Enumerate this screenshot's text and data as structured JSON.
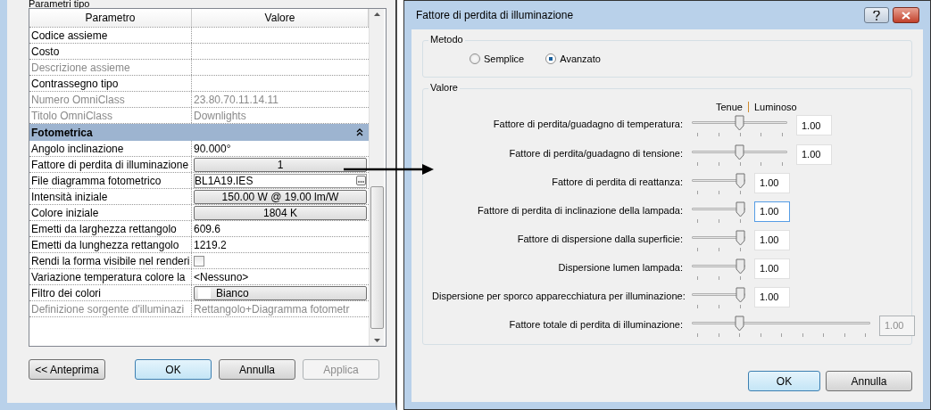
{
  "type_dialog": {
    "group_label": "Parametri tipo",
    "table": {
      "columns": [
        "Parametro",
        "Valore"
      ],
      "rows": [
        {
          "kind": "text",
          "name": "Codice assieme",
          "disabled": false
        },
        {
          "kind": "text",
          "name": "Costo",
          "disabled": false
        },
        {
          "kind": "text",
          "name": "Descrizione assieme",
          "disabled": true
        },
        {
          "kind": "text",
          "name": "Contrassegno tipo",
          "disabled": false
        },
        {
          "kind": "text",
          "name": "Numero OmniClass",
          "value": "23.80.70.11.14.11",
          "disabled": true
        },
        {
          "kind": "text",
          "name": "Titolo OmniClass",
          "value": "Downlights",
          "disabled": true
        },
        {
          "kind": "group",
          "label": "Fotometrica",
          "expanded": true
        },
        {
          "kind": "text",
          "name": "Angolo inclinazione",
          "value": "90.000°",
          "disabled": false
        },
        {
          "kind": "button",
          "name": "Fattore di perdita di illuminazione",
          "value": "1",
          "disabled": false
        },
        {
          "kind": "file",
          "name": "File diagramma fotometrico",
          "value": "BL1A19.IES",
          "disabled": false
        },
        {
          "kind": "button",
          "name": "Intensità iniziale",
          "value": "150.00 W @ 19.00 lm/W",
          "disabled": false
        },
        {
          "kind": "button",
          "name": "Colore iniziale",
          "value": "1804 K",
          "disabled": false
        },
        {
          "kind": "text",
          "name": "Emetti da larghezza rettangolo",
          "value": "609.6",
          "disabled": false
        },
        {
          "kind": "text",
          "name": "Emetti da lunghezza rettangolo",
          "value": "1219.2",
          "disabled": false
        },
        {
          "kind": "checkbox",
          "name": "Rendi la forma visibile nel renderi",
          "checked": false,
          "disabled": false
        },
        {
          "kind": "text",
          "name": "Variazione temperatura colore la",
          "value": "<Nessuno>",
          "disabled": false
        },
        {
          "kind": "color",
          "name": "Filtro dei colori",
          "value": "Bianco",
          "color": "#ffffff",
          "disabled": false
        },
        {
          "kind": "text",
          "name": "Definizione sorgente d'illuminazi",
          "value": "Rettangolo+Diagramma fotometr",
          "disabled": true
        }
      ]
    },
    "buttons": [
      {
        "label": "<< Anteprima",
        "default": false,
        "disabled": false
      },
      {
        "label": "OK",
        "default": true,
        "disabled": false
      },
      {
        "label": "Annulla",
        "default": false,
        "disabled": false
      },
      {
        "label": "Applica",
        "default": false,
        "disabled": true
      }
    ]
  },
  "loss_dialog": {
    "title": "Fattore di perdita di illuminazione",
    "method": {
      "label": "Metodo",
      "options": [
        {
          "label": "Semplice",
          "selected": false
        },
        {
          "label": "Avanzato",
          "selected": true
        }
      ]
    },
    "values": {
      "label": "Valore",
      "scale_low": "Tenue",
      "scale_high": "Luminoso",
      "rows": [
        {
          "label": "Fattore di perdita/guadagno di temperatura:",
          "kind": "standard",
          "level": 0.5,
          "value": "1.00",
          "focused": false,
          "disabled": false
        },
        {
          "label": "Fattore di perdita/guadagno di tensione:",
          "kind": "standard",
          "level": 0.5,
          "value": "1.00",
          "focused": false,
          "disabled": false
        },
        {
          "label": "Fattore di perdita di reattanza:",
          "kind": "capped",
          "level": 1,
          "value": "1.00",
          "focused": false,
          "disabled": false
        },
        {
          "label": "Fattore di perdita di inclinazione della lampada:",
          "kind": "capped",
          "level": 1,
          "value": "1.00",
          "focused": true,
          "disabled": false
        },
        {
          "label": "Fattore di dispersione dalla superficie:",
          "kind": "capped",
          "level": 1,
          "value": "1.00",
          "focused": false,
          "disabled": false
        },
        {
          "label": "Dispersione lumen lampada:",
          "kind": "capped",
          "level": 1,
          "value": "1.00",
          "focused": false,
          "disabled": false
        },
        {
          "label": "Dispersione per sporco apparecchiatura per illuminazione:",
          "kind": "capped",
          "level": 1,
          "value": "1.00",
          "focused": false,
          "disabled": false
        },
        {
          "label": "Fattore totale di perdita di illuminazione:",
          "kind": "total",
          "level": 0.25,
          "value": "1.00",
          "focused": false,
          "disabled": true
        }
      ]
    },
    "buttons": [
      {
        "label": "OK",
        "default": true
      },
      {
        "label": "Annulla",
        "default": false
      }
    ]
  }
}
